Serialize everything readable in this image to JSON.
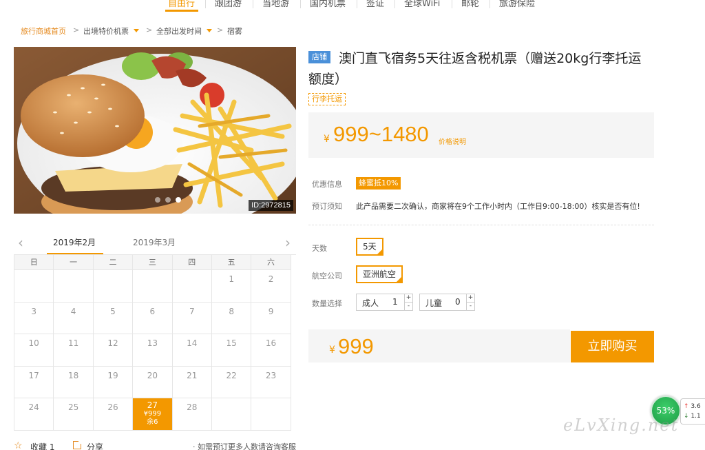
{
  "topnav": {
    "items": [
      {
        "label": "自由行",
        "active": true
      },
      {
        "label": "跟团游"
      },
      {
        "label": "当地游"
      },
      {
        "label": "国内机票"
      },
      {
        "label": "签证"
      },
      {
        "label": "全球WiFi"
      },
      {
        "label": "邮轮"
      },
      {
        "label": "旅游保险"
      }
    ]
  },
  "breadcrumb": {
    "home": "旅行商城首页",
    "sep": ">",
    "level1": "出境特价机票",
    "level2": "全部出发时间",
    "current": "宿雾"
  },
  "hero": {
    "image_desc": "汉堡 薯条 煎蛋",
    "id_tag": "ID:2972815",
    "slides": 3,
    "active_slide": 3
  },
  "calendar": {
    "prev_icon": "‹",
    "next_icon": "›",
    "month_current": "2019年2月",
    "month_next": "2019年3月",
    "weekdays": [
      "日",
      "一",
      "二",
      "三",
      "四",
      "五",
      "六"
    ],
    "weeks": [
      [
        "",
        "",
        "",
        "",
        "",
        "1",
        "2"
      ],
      [
        "3",
        "4",
        "5",
        "6",
        "7",
        "8",
        "9"
      ],
      [
        "10",
        "11",
        "12",
        "13",
        "14",
        "15",
        "16"
      ],
      [
        "17",
        "18",
        "19",
        "20",
        "21",
        "22",
        "23"
      ],
      [
        "24",
        "25",
        "26",
        "27",
        "28",
        "",
        ""
      ]
    ],
    "selected": {
      "day": "27",
      "price": "¥999",
      "left": "余6"
    }
  },
  "actions": {
    "favorite": "收藏 1",
    "share": "分享",
    "more": "· 如需预订更多人数请咨询客服"
  },
  "product": {
    "shop_badge": "店铺",
    "title": "澳门直飞宿务5天往返含税机票（赠送20kg行李托运额度）",
    "tag": "行李托运",
    "price_currency": "¥",
    "price_range": "999~1480",
    "price_note": "价格说明",
    "promo_label": "优惠信息",
    "promo_value": "蜂蜜抵10%",
    "notice_label": "预订须知",
    "notice_text": "此产品需要二次确认，商家将在9个工作小时内（工作日9:00-18:00）核实是否有位!",
    "days_label": "天数",
    "days_value": "5天",
    "airline_label": "航空公司",
    "airline_value": "亚洲航空",
    "qty_label": "数量选择",
    "adult_label": "成人",
    "adult_value": "1",
    "child_label": "儿童",
    "child_value": "0",
    "plus": "+",
    "minus": "-",
    "total_currency": "¥",
    "total": "999",
    "buy_button": "立即购买"
  },
  "widget": {
    "gauge": "53%",
    "up_arrow": "↑",
    "up_value": "3.6",
    "down_arrow": "↓",
    "down_value": "1.1",
    "watermark": "eLvXing.net"
  },
  "colors": {
    "accent": "#f39800",
    "badge_blue": "#4a90d9",
    "gauge_green": "#2bb556"
  }
}
